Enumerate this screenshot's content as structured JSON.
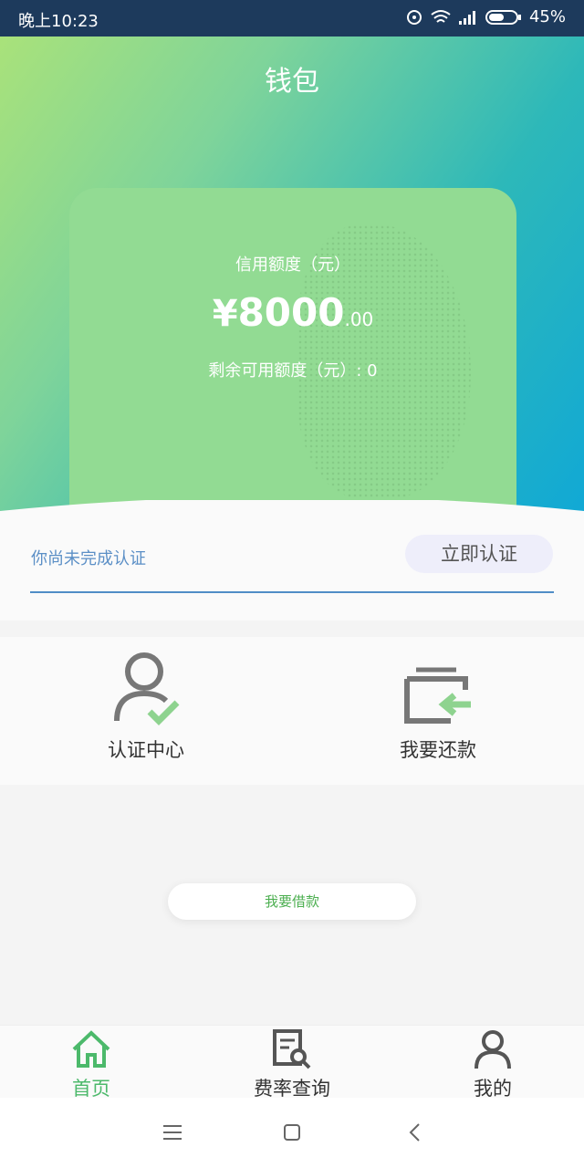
{
  "status": {
    "time": "晚上10:23",
    "battery": "45%"
  },
  "header": {
    "title": "钱包"
  },
  "card": {
    "credit_label": "信用额度（元）",
    "currency": "¥",
    "amount_int": "8000",
    "amount_dec": ".00",
    "remaining": "剩余可用额度（元）: 0"
  },
  "verify": {
    "message": "你尚未完成认证",
    "button": "立即认证"
  },
  "actions": [
    {
      "label": "认证中心",
      "icon": "person-check-icon"
    },
    {
      "label": "我要还款",
      "icon": "wallet-return-icon"
    }
  ],
  "borrow_button": "我要借款",
  "tabs": [
    {
      "label": "首页",
      "icon": "home-icon",
      "active": true
    },
    {
      "label": "费率查询",
      "icon": "document-search-icon",
      "active": false
    },
    {
      "label": "我的",
      "icon": "user-icon",
      "active": false
    }
  ],
  "colors": {
    "accent": "#4cb96b",
    "card": "#92db93",
    "link": "#5b8fc6"
  }
}
